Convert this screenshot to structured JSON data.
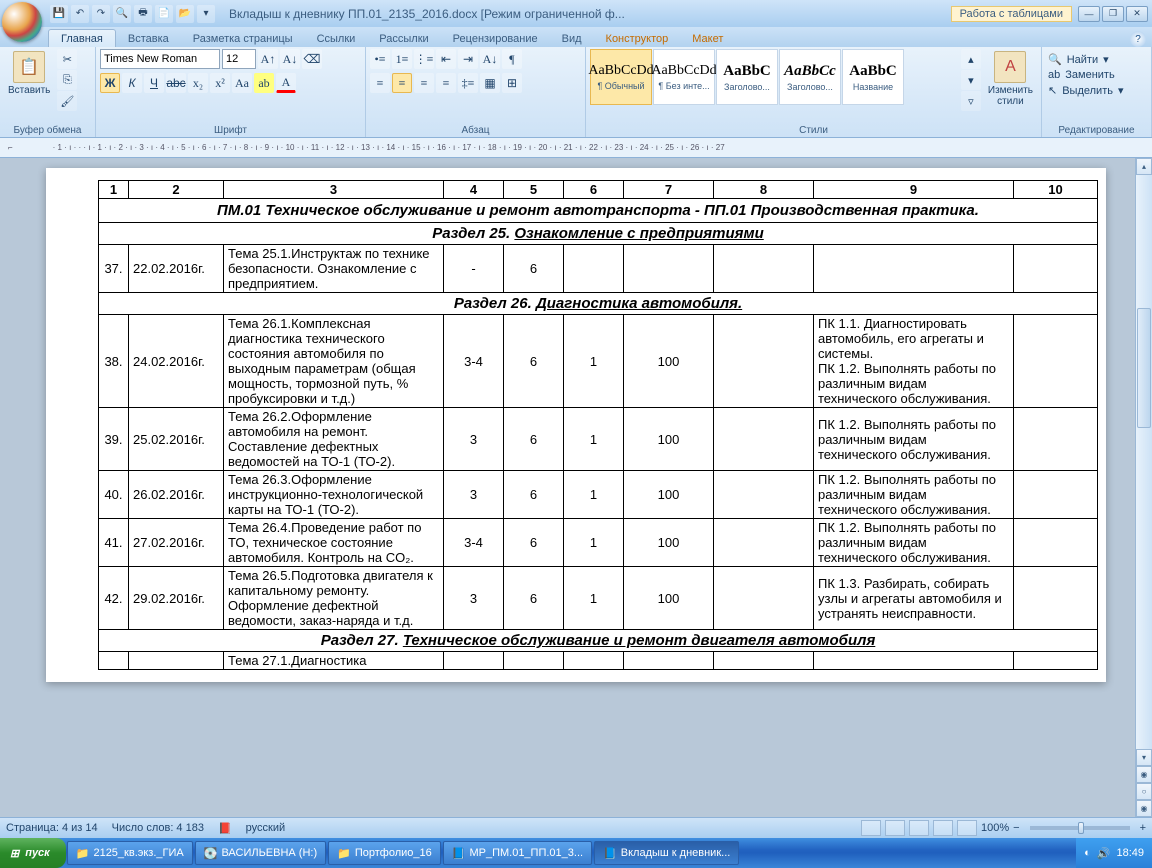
{
  "window": {
    "title": "Вкладыш к дневнику ПП.01_2135_2016.docx [Режим ограниченной ф...",
    "tabletools": "Работа с таблицами"
  },
  "tabs": {
    "home": "Главная",
    "insert": "Вставка",
    "layout": "Разметка страницы",
    "refs": "Ссылки",
    "mail": "Рассылки",
    "review": "Рецензирование",
    "view": "Вид",
    "design": "Конструктор",
    "tlayout": "Макет"
  },
  "ribbon": {
    "clipboard": {
      "label": "Буфер обмена",
      "paste": "Вставить"
    },
    "font": {
      "label": "Шрифт",
      "name": "Times New Roman",
      "size": "12"
    },
    "para": {
      "label": "Абзац"
    },
    "styles": {
      "label": "Стили",
      "s1": "¶ Обычный",
      "s2": "¶ Без инте...",
      "s3": "Заголово...",
      "s4": "Заголово...",
      "s5": "Название",
      "change": "Изменить\nстили"
    },
    "editing": {
      "label": "Редактирование",
      "find": "Найти",
      "replace": "Заменить",
      "select": "Выделить"
    }
  },
  "sample": {
    "a": "AaBbCcDd",
    "b": "AaBbCcDd",
    "c": "AaBbC",
    "d": "AaBbCc",
    "e": "AaBbC"
  },
  "doc": {
    "cols": [
      "1",
      "2",
      "3",
      "4",
      "5",
      "6",
      "7",
      "8",
      "9",
      "10"
    ],
    "header": "ПМ.01 Техническое  обслуживание и ремонт автотранспорта - ПП.01 Производственная практика.",
    "sec25": {
      "pre": "Раздел 25.  ",
      "title": "Ознакомление с предприятиями"
    },
    "r37": {
      "n": "37.",
      "d": "22.02.2016г.",
      "t": "Тема 25.1.Инструктаж по технике безопасности. Ознакомление с предприятием.",
      "c4": "-",
      "c5": "6"
    },
    "sec26": {
      "pre": "Раздел 26.  ",
      "title": "Диагностика автомобиля."
    },
    "r38": {
      "n": "38.",
      "d": "24.02.2016г.",
      "t": "Тема 26.1.Комплексная диагностика технического состояния автомобиля  по выходным параметрам (общая мощность,  тормозной путь, % пробуксировки и т.д.)",
      "c4": "3-4",
      "c5": "6",
      "c6": "1",
      "c7": "100",
      "pk": "ПК 1.1.  Диагностировать автомобиль, его агрегаты и системы.\nПК 1.2.  Выполнять работы по различным видам технического обслуживания."
    },
    "r39": {
      "n": "39.",
      "d": "25.02.2016г.",
      "t": "Тема 26.2.Оформление автомобиля на ремонт. Составление дефектных ведомостей на ТО-1 (ТО-2).",
      "c4": "3",
      "c5": "6",
      "c6": "1",
      "c7": "100",
      "pk": "ПК 1.2.  Выполнять работы по различным видам технического обслуживания."
    },
    "r40": {
      "n": "40.",
      "d": "26.02.2016г.",
      "t": "Тема 26.3.Оформление инструкционно-технологической карты на ТО-1 (ТО-2).",
      "c4": "3",
      "c5": "6",
      "c6": "1",
      "c7": "100",
      "pk": "ПК 1.2.  Выполнять работы по различным видам технического обслуживания."
    },
    "r41": {
      "n": "41.",
      "d": "27.02.2016г.",
      "t": "Тема 26.4.Проведение работ по ТО,   техническое состояние автомобиля. Контроль на CO₂.",
      "c4": "3-4",
      "c5": "6",
      "c6": "1",
      "c7": "100",
      "pk": "ПК 1.2.  Выполнять работы по различным видам технического обслуживания."
    },
    "r42": {
      "n": "42.",
      "d": "29.02.2016г.",
      "t": "Тема 26.5.Подготовка двигателя к капитальному ремонту. Оформление дефектной ведомости, заказ-наряда и т.д.",
      "c4": "3",
      "c5": "6",
      "c6": "1",
      "c7": "100",
      "pk": "ПК 1.3.  Разбирать, собирать узлы и агрегаты автомобиля и устранять неисправности."
    },
    "sec27": {
      "pre": "Раздел 27. ",
      "title": "Техническое обслуживание и ремонт двигателя автомобиля"
    },
    "r43t": "Тема 27.1.Диагностика"
  },
  "status": {
    "page": "Страница: 4 из 14",
    "words": "Число слов: 4 183",
    "lang": "русский",
    "zoom": "100%"
  },
  "taskbar": {
    "start": "пуск",
    "i1": "2125_кв.экз._ГИА",
    "i2": "ВАСИЛЬЕВНА (H:)",
    "i3": "Портфолио_16",
    "i4": "МР_ПМ.01_ПП.01_3...",
    "i5": "Вкладыш к дневник...",
    "time": "18:49"
  }
}
